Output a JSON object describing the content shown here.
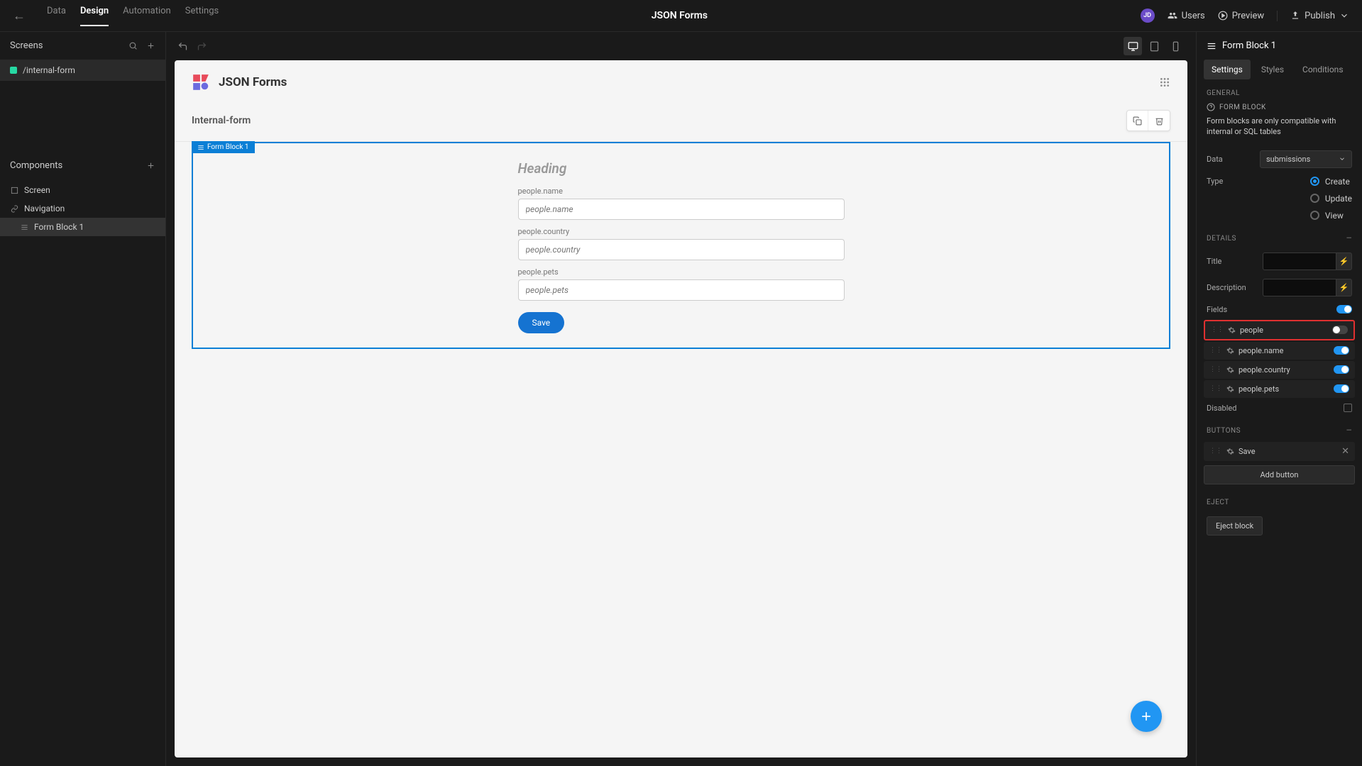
{
  "topbar": {
    "tabs": [
      "Data",
      "Design",
      "Automation",
      "Settings"
    ],
    "active_tab": "Design",
    "app_name": "JSON Forms",
    "avatar": "JD",
    "users_label": "Users",
    "preview_label": "Preview",
    "publish_label": "Publish"
  },
  "left": {
    "screens_label": "Screens",
    "screen_item": "/internal-form",
    "components_label": "Components",
    "components": [
      {
        "label": "Screen",
        "icon": "square"
      },
      {
        "label": "Navigation",
        "icon": "eye"
      },
      {
        "label": "Form Block 1",
        "icon": "form",
        "selected": true
      }
    ]
  },
  "canvas": {
    "app_title": "JSON Forms",
    "page_title": "Internal-form",
    "block_tag": "Form Block 1",
    "form_heading": "Heading",
    "fields": [
      {
        "label": "people.name",
        "placeholder": "people.name"
      },
      {
        "label": "people.country",
        "placeholder": "people.country"
      },
      {
        "label": "people.pets",
        "placeholder": "people.pets"
      }
    ],
    "save_label": "Save"
  },
  "right": {
    "header": "Form Block 1",
    "tabs": [
      "Settings",
      "Styles",
      "Conditions"
    ],
    "active_tab": "Settings",
    "sections": {
      "general": "GENERAL",
      "details": "DETAILS",
      "buttons": "BUTTONS",
      "eject": "EJECT"
    },
    "info_title": "FORM BLOCK",
    "info_text": "Form blocks are only compatible with internal or SQL tables",
    "data_label": "Data",
    "data_value": "submissions",
    "type_label": "Type",
    "type_options": [
      "Create",
      "Update",
      "View"
    ],
    "type_selected": "Create",
    "title_label": "Title",
    "description_label": "Description",
    "fields_label": "Fields",
    "fields": [
      {
        "name": "people",
        "enabled": false,
        "highlighted": true
      },
      {
        "name": "people.name",
        "enabled": true
      },
      {
        "name": "people.country",
        "enabled": true
      },
      {
        "name": "people.pets",
        "enabled": true
      }
    ],
    "disabled_label": "Disabled",
    "buttons_list": [
      {
        "name": "Save"
      }
    ],
    "add_button_label": "Add button",
    "eject_button_label": "Eject block"
  }
}
